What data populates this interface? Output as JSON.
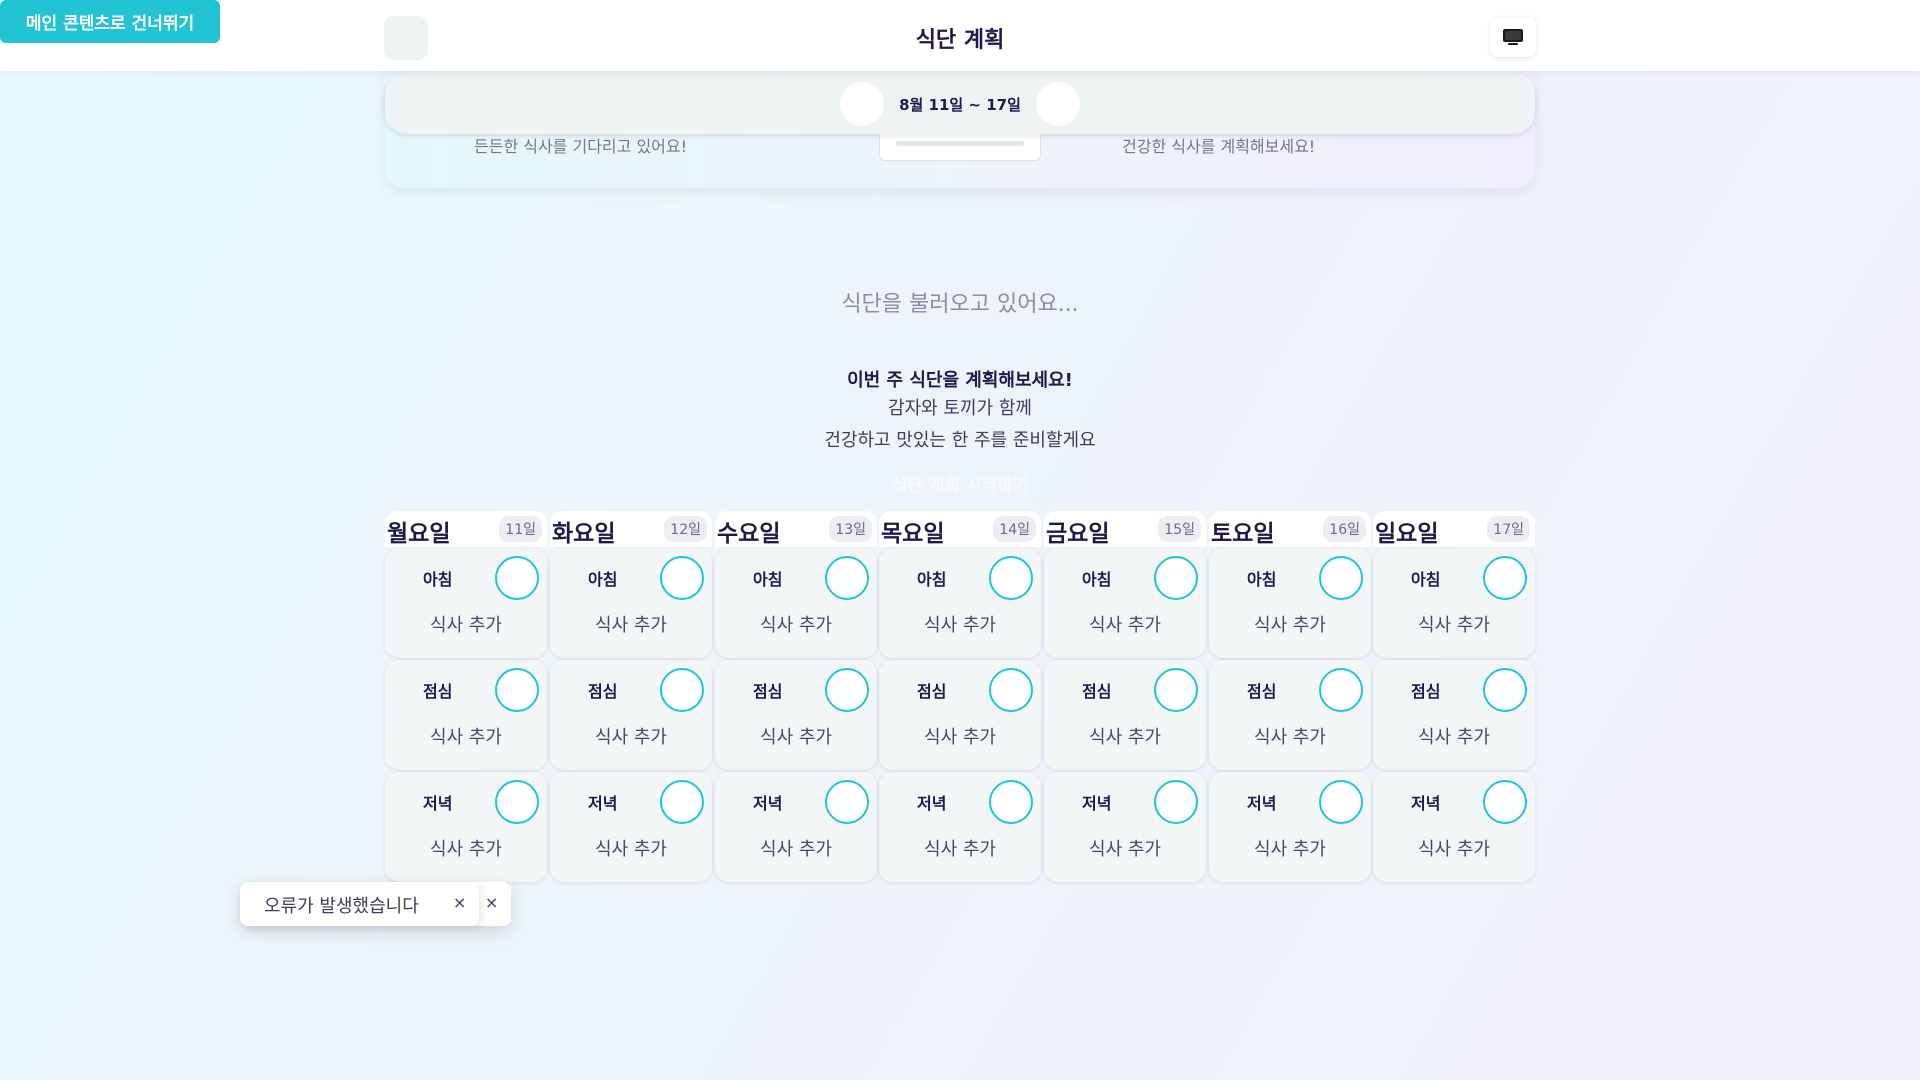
{
  "skip_link": "메인 콘텐츠로 건너뛰기",
  "header": {
    "title": "식단 계획"
  },
  "hero": {
    "week_label": "8월 11일 ~ 17일",
    "left_text": "든든한 식사를 기다리고 있어요!",
    "right_text": "건강한 식사를 계획해보세요!"
  },
  "loading": "식단을 불러오고 있어요...",
  "empty": {
    "title": "이번 주 식단을 계획해보세요!",
    "line1": "감자와 토끼가 함께",
    "line2": "건강하고 맛있는 한 주를 준비할게요",
    "start_button": "식단 계획 시작하기"
  },
  "days": [
    {
      "name": "월요일",
      "date": "11일"
    },
    {
      "name": "화요일",
      "date": "12일"
    },
    {
      "name": "수요일",
      "date": "13일"
    },
    {
      "name": "목요일",
      "date": "14일"
    },
    {
      "name": "금요일",
      "date": "15일"
    },
    {
      "name": "토요일",
      "date": "16일"
    },
    {
      "name": "일요일",
      "date": "17일"
    }
  ],
  "meals": [
    "아침",
    "점심",
    "저녁"
  ],
  "add_meal_label": "식사 추가",
  "toast": {
    "message": "오류가 발생했습니다",
    "close_label": "×"
  },
  "colors": {
    "accent": "#22c3d4",
    "title": "#1e1b4b"
  }
}
